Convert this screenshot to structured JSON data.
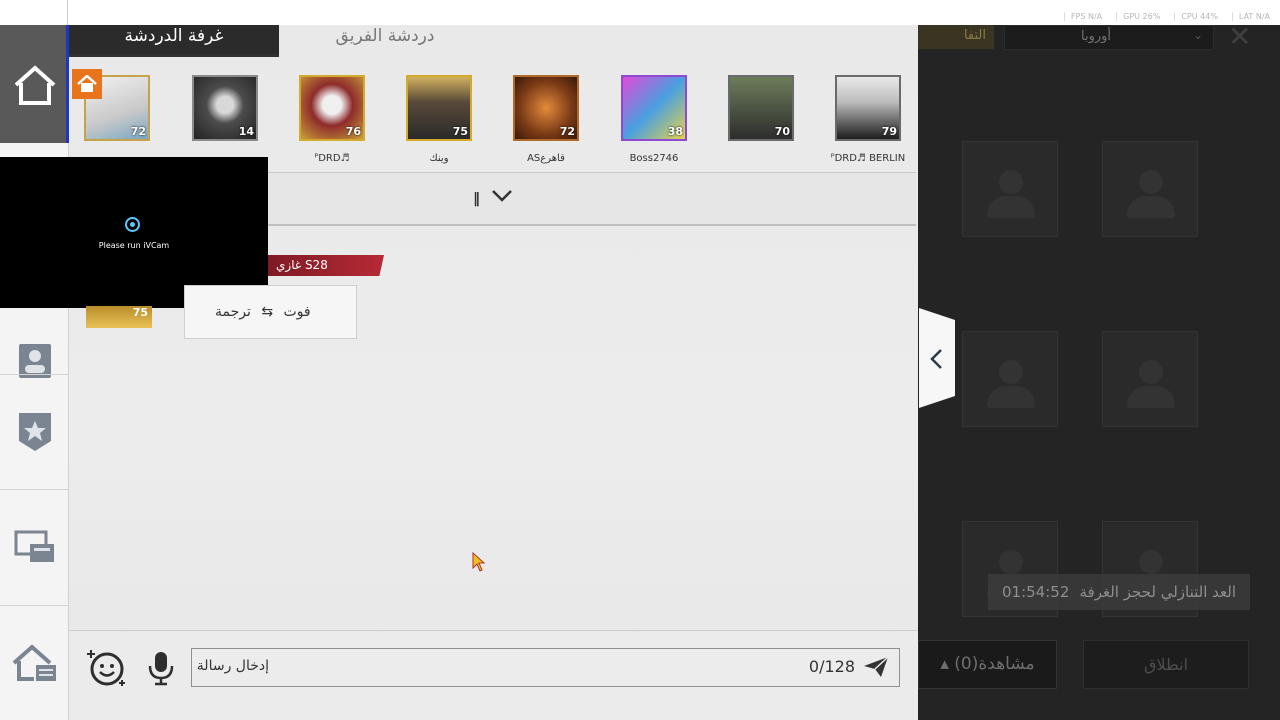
{
  "stats": [
    "FPS N/A",
    "GPU 26%",
    "CPU 44%",
    "LAT N/A"
  ],
  "tabs": {
    "active": "غرفة الدردشة",
    "team": "دردشة الفريق"
  },
  "roster": [
    {
      "name": "",
      "level": "72"
    },
    {
      "name": "",
      "level": "14"
    },
    {
      "name": "ᴾDRD♬",
      "level": "76"
    },
    {
      "name": "وينك",
      "level": "75"
    },
    {
      "name": "ASقاهرع",
      "level": "72"
    },
    {
      "name": "Boss2746",
      "level": "38"
    },
    {
      "name": "",
      "level": "70"
    },
    {
      "name": "ᴾDRD♬ BERLIN",
      "level": "79"
    }
  ],
  "ivcam": {
    "text": "Please run iVCam"
  },
  "message": {
    "sender": "غازي S28",
    "avatar_level": "75",
    "translate_label": "ترجمة",
    "text": "فوت"
  },
  "input": {
    "placeholder": "إدخال رسالة",
    "counter": "0/128"
  },
  "game": {
    "tab_label": "التفا",
    "region": "أوروبا",
    "countdown_label": "العد التنازلي لحجز الغرفة",
    "countdown_time": "01:54:52",
    "watch_label": "(0)مشاهدة",
    "launch_label": "انطلاق"
  },
  "colors": {
    "accent_blue": "#2233c8",
    "home_badge": "#e8741c",
    "sender_red": "#b72a36"
  }
}
